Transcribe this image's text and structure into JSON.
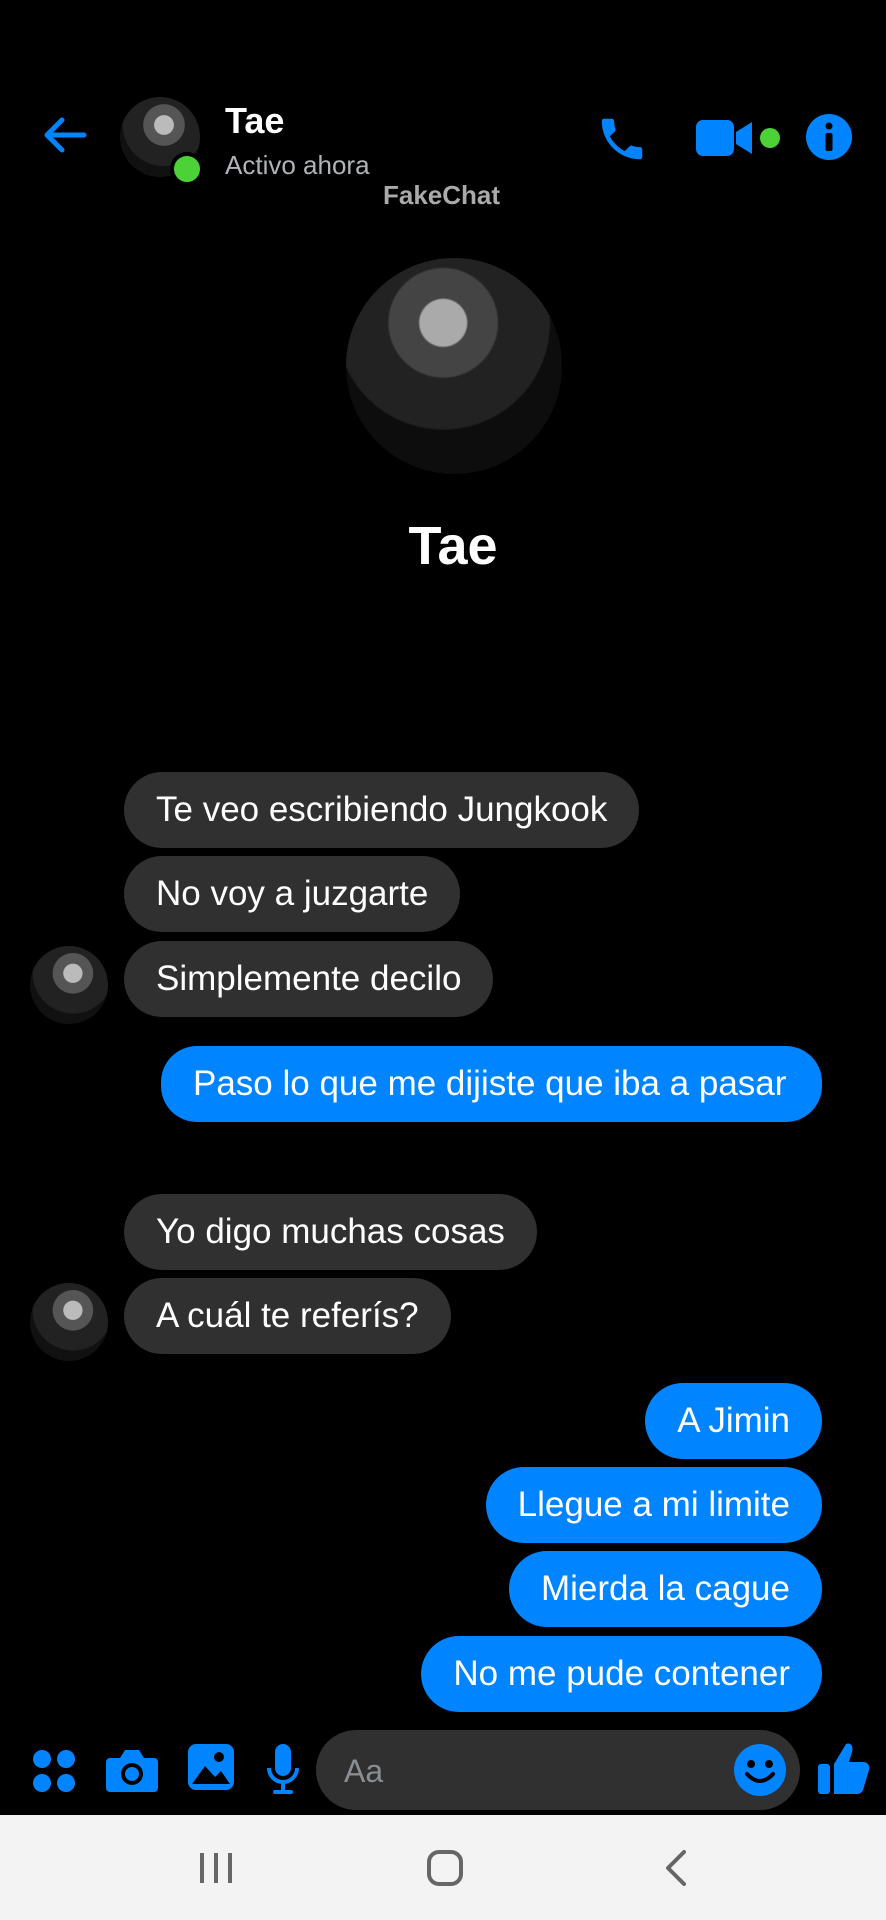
{
  "header": {
    "contact_name": "Tae",
    "status": "Activo ahora",
    "watermark": "FakeChat"
  },
  "profile": {
    "name": "Tae"
  },
  "messages": [
    {
      "side": "received",
      "text": "Te veo escribiendo Jungkook"
    },
    {
      "side": "received",
      "text": "No voy a juzgarte"
    },
    {
      "side": "received",
      "text": "Simplemente decilo"
    },
    {
      "side": "sent",
      "text": "Paso lo que me dijiste que iba a pasar"
    },
    {
      "side": "received",
      "text": "Yo digo muchas cosas"
    },
    {
      "side": "received",
      "text": "A cuál te referís?"
    },
    {
      "side": "sent",
      "text": "A Jimin"
    },
    {
      "side": "sent",
      "text": "Llegue a mi limite"
    },
    {
      "side": "sent",
      "text": "Mierda la cague"
    },
    {
      "side": "sent",
      "text": "No me pude contener"
    }
  ],
  "composer": {
    "placeholder": "Aa"
  },
  "colors": {
    "accent": "#0084ff",
    "online": "#4cd137",
    "received_bubble": "#303030",
    "background": "#000000"
  },
  "icons": {
    "back": "arrow-left-icon",
    "call": "phone-icon",
    "video": "video-camera-icon",
    "info": "info-icon",
    "apps": "four-dots-icon",
    "camera": "camera-icon",
    "gallery": "image-icon",
    "mic": "microphone-icon",
    "emoji": "smiley-icon",
    "like": "thumbs-up-icon"
  }
}
